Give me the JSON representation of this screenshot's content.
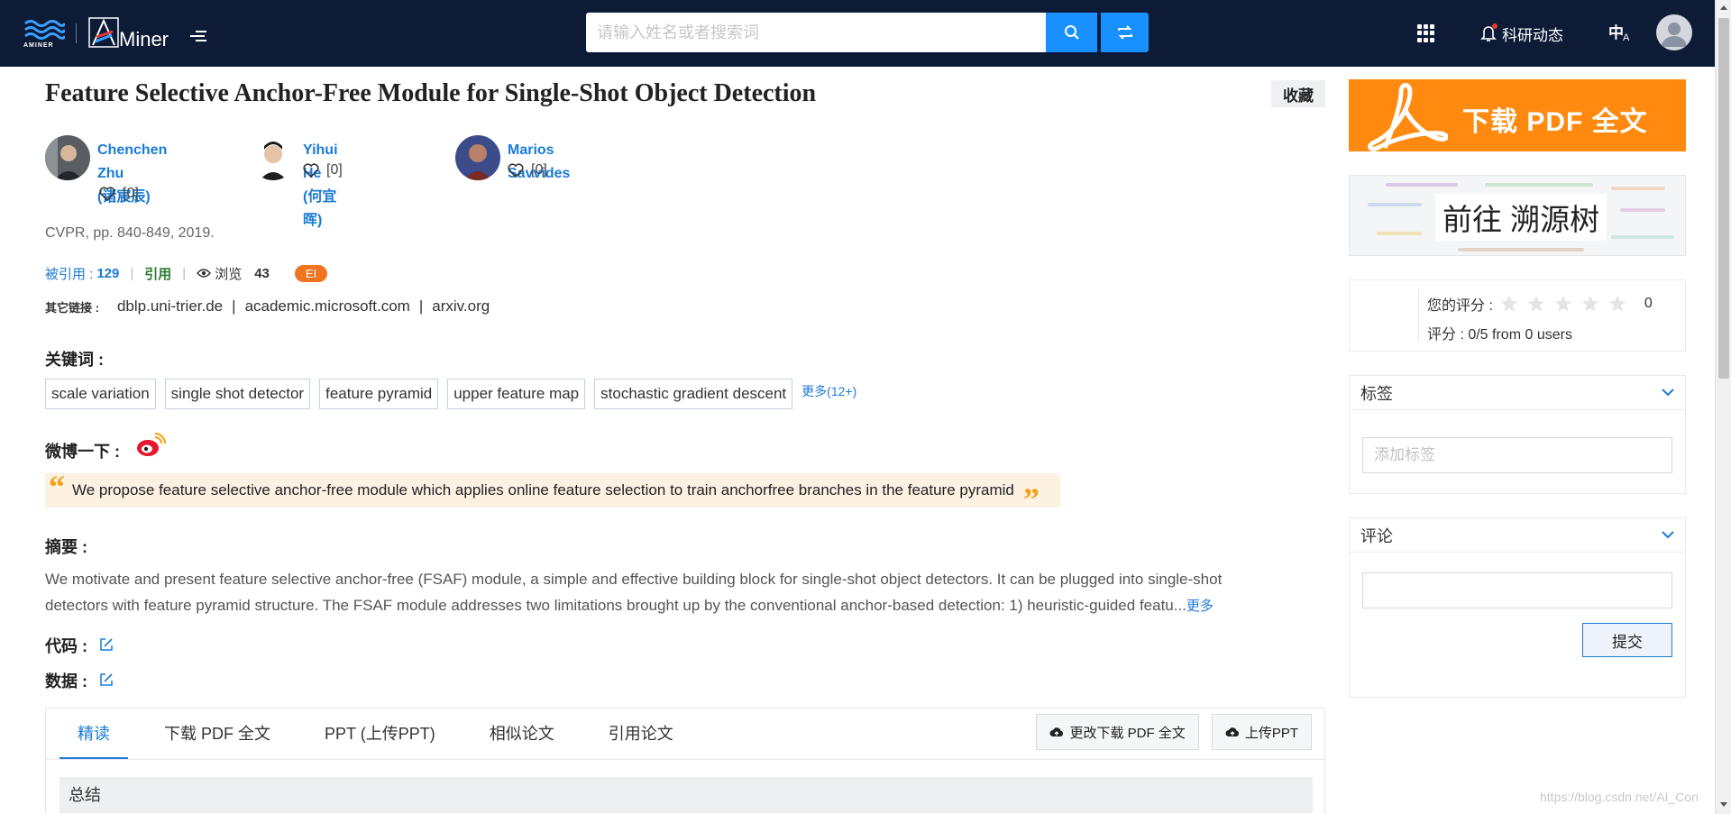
{
  "brand": {
    "org_logo_text": "AMINER",
    "app_name": "Miner"
  },
  "search": {
    "placeholder": "请输入姓名或者搜索词",
    "value": ""
  },
  "nav": {
    "news_label": "科研动态",
    "lang_zh": "中",
    "lang_en": "A"
  },
  "paper": {
    "title": "Feature Selective Anchor-Free Module for Single-Shot Object Detection",
    "collect_label": "收藏",
    "venue": "CVPR, pp. 840-849, 2019.",
    "authors": [
      {
        "name_line1": "Chenchen Zhu",
        "name_line2": "(诸宸辰)",
        "likes": "[0]"
      },
      {
        "name_line1": "Yihui He (何宜晖)",
        "likes": "[0]"
      },
      {
        "name_line1": "Marios Savvides",
        "likes": "[0]"
      }
    ],
    "stats": {
      "cited_label": "被引用 :",
      "cited_count": "129",
      "cite_label": "引用",
      "views_label": "浏览",
      "views_count": "43",
      "badge": "EI"
    },
    "other_links": {
      "label": "其它链接 :",
      "links": [
        "dblp.uni-trier.de",
        "academic.microsoft.com",
        "arxiv.org"
      ]
    },
    "keywords": {
      "heading": "关键词 :",
      "items": [
        "scale variation",
        "single shot detector",
        "feature pyramid",
        "upper feature map",
        "stochastic gradient descent"
      ],
      "more": "更多(12+)"
    },
    "weibo": {
      "heading": "微博一下 :",
      "quote": "We propose feature selective anchor-free module which applies online feature selection to train anchorfree branches in the feature pyramid"
    },
    "abstract": {
      "heading": "摘要 :",
      "line1": "We motivate and present feature selective anchor-free (FSAF) module, a simple and effective building block for single-shot object detectors. It can be plugged into single-shot",
      "line2": "detectors with feature pyramid structure. The FSAF module addresses two limitations brought up by the conventional anchor-based detection: 1) heuristic-guided featu...",
      "more": "更多"
    },
    "code_heading": "代码 :",
    "data_heading": "数据 :"
  },
  "tabs": {
    "items": [
      "精读",
      "下载 PDF 全文",
      "PPT (上传PPT)",
      "相似论文",
      "引用论文"
    ],
    "active": 0,
    "change_pdf": "更改下载 PDF 全文",
    "upload_ppt": "上传PPT",
    "summary": "总结"
  },
  "sidebar": {
    "pdf_banner": "下载 PDF 全文",
    "trace_banner": "前往 溯源树",
    "rating": {
      "label": "您的评分 :",
      "stars_max": 5,
      "stars_value": 0,
      "count": "0",
      "summary": "评分 : 0/5 from 0 users"
    },
    "tags": {
      "title": "标签",
      "placeholder": "添加标签"
    },
    "comments": {
      "title": "评论",
      "submit": "提交"
    }
  },
  "watermark": "https://blog.csdn.net/AI_Con",
  "colors": {
    "nav_bg": "#0d1b37",
    "accent": "#1a7bd6",
    "search_button": "#1890ff",
    "pdf_orange": "#ff8a0f",
    "badge_orange": "#f07521",
    "quote_bg": "#fdf1e2",
    "cite_green": "#2e7d32"
  },
  "icons": [
    "logo-waves-icon",
    "menu-toggle-icon",
    "search-icon",
    "swap-icon",
    "apps-grid-icon",
    "bell-icon",
    "heart-icon",
    "eye-icon",
    "weibo-icon",
    "edit-icon",
    "cloud-upload-icon",
    "acrobat-icon",
    "star-icon",
    "chevron-down-icon"
  ]
}
